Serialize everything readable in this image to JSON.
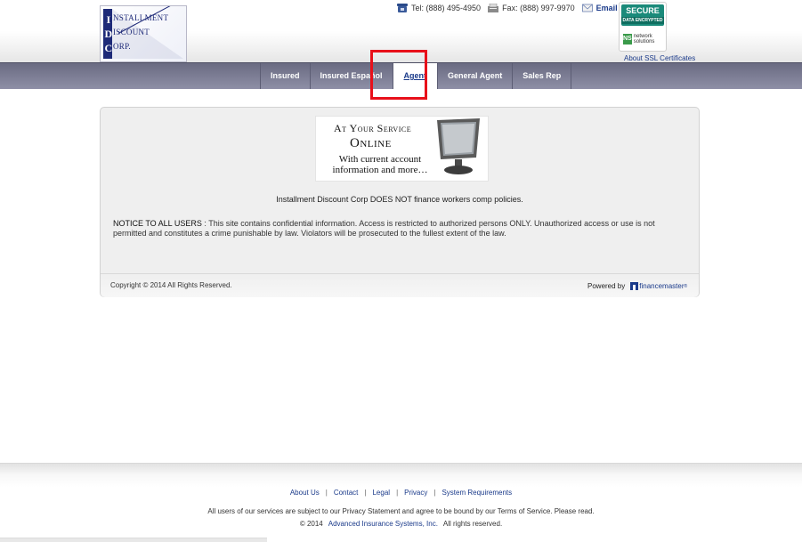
{
  "logo": {
    "lines": [
      "NSTALLMENT",
      "ISCOUNT",
      "ORP."
    ],
    "caps": [
      "I",
      "D",
      "C"
    ]
  },
  "contact": {
    "tel": "Tel: (888) 495-4950",
    "fax": "Fax: (888) 997-9970",
    "email": "Email Us"
  },
  "secure_badge": {
    "title": "SECURE",
    "subtitle": "DATA ENCRYPTED",
    "brand_mark": "NS",
    "brand": "network solutions"
  },
  "ssl_link": "About SSL Certificates",
  "nav": {
    "tabs": [
      {
        "label": "Insured",
        "active": false
      },
      {
        "label": "Insured Español",
        "active": false
      },
      {
        "label": "Agent",
        "active": true
      },
      {
        "label": "General Agent",
        "active": false
      },
      {
        "label": "Sales Rep",
        "active": false
      }
    ]
  },
  "banner": {
    "line1": "At Your Service",
    "line2": "Online",
    "line3": "With current account information and more…"
  },
  "main": {
    "note": "Installment Discount Corp DOES NOT finance workers comp policies.",
    "notice_lead": "NOTICE TO ALL USERS",
    "notice_body": " : This site contains confidential information. Access is restricted to authorized persons ONLY. Unauthorized access or use is not permitted and constitutes a crime punishable by law. Violators will be prosecuted to the fullest extent of the law."
  },
  "panel_footer": {
    "copyright": "Copyright © 2014 All Rights Reserved.",
    "powered_by": "Powered by",
    "fm_brand": "financemaster"
  },
  "footer": {
    "links": [
      "About Us",
      "Contact",
      "Legal",
      "Privacy",
      "System Requirements"
    ],
    "terms": "All users of our services are subject to our Privacy Statement and agree to be bound by our Terms of Service. Please read.",
    "copy_prefix": "© 2014",
    "copy_link": "Advanced Insurance Systems, Inc.",
    "copy_suffix": "All rights reserved."
  },
  "colors": {
    "nav_bg": "#7d7e96",
    "link": "#1a3a8a",
    "highlight": "#e8101a",
    "logo_blue": "#1e2a78"
  }
}
